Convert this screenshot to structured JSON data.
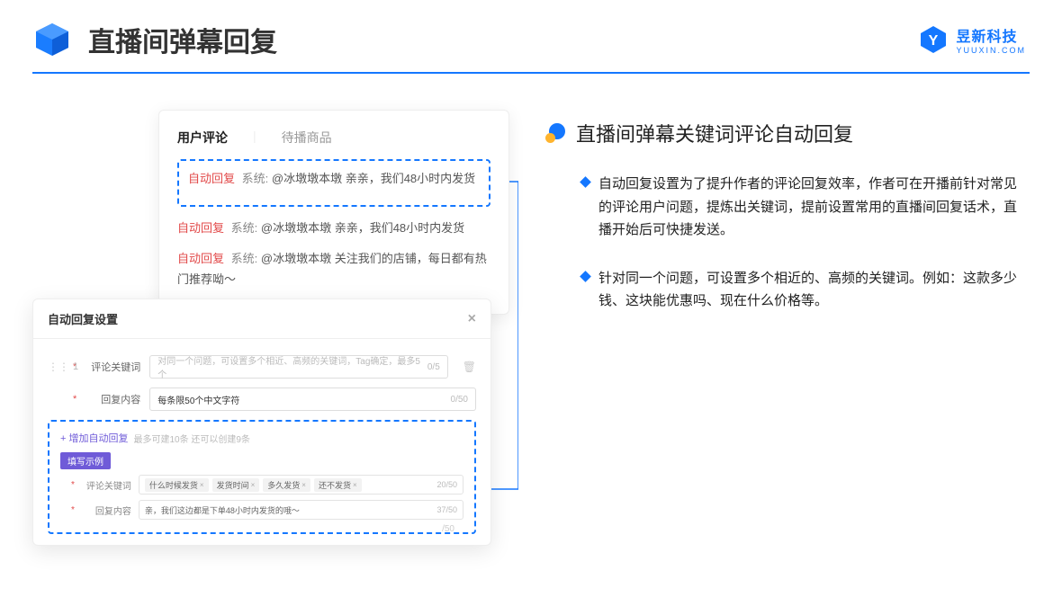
{
  "header": {
    "title": "直播间弹幕回复",
    "brandCn": "昱新科技",
    "brandEn": "YUUXIN.COM"
  },
  "commentCard": {
    "tabActive": "用户评论",
    "tabOther": "待播商品",
    "highlighted": {
      "tag": "自动回复",
      "sys": "系统:",
      "text": "@冰墩墩本墩 亲亲，我们48小时内发货"
    },
    "c2": {
      "tag": "自动回复",
      "sys": "系统:",
      "text": "@冰墩墩本墩 亲亲，我们48小时内发货"
    },
    "c3": {
      "tag": "自动回复",
      "sys": "系统:",
      "text": "@冰墩墩本墩 关注我们的店铺，每日都有热门推荐呦～"
    }
  },
  "settings": {
    "title": "自动回复设置",
    "idx": "1",
    "r1": {
      "label": "评论关键词",
      "ph": "对同一个问题，可设置多个相近、高频的关键词，Tag确定，最多5个",
      "cnt": "0/5"
    },
    "r2": {
      "label": "回复内容",
      "ph": "每条限50个中文字符",
      "cnt": "0/50"
    },
    "add": "+ 增加自动回复",
    "addHint": "最多可建10条 还可以创建9条",
    "badge": "填写示例",
    "ex1": {
      "label": "评论关键词",
      "k1": "什么时候发货",
      "k2": "发货时间",
      "k3": "多久发货",
      "k4": "还不发货",
      "cnt": "20/50"
    },
    "ex2": {
      "label": "回复内容",
      "txt": "亲，我们这边都是下单48小时内发货的哦～",
      "cnt": "37/50"
    },
    "stray": "/50"
  },
  "right": {
    "sectionTitle": "直播间弹幕关键词评论自动回复",
    "p1": "自动回复设置为了提升作者的评论回复效率，作者可在开播前针对常见的评论用户问题，提炼出关键词，提前设置常用的直播间回复话术，直播开始后可快捷发送。",
    "p2": "针对同一个问题，可设置多个相近的、高频的关键词。例如：这款多少钱、这块能优惠吗、现在什么价格等。"
  }
}
